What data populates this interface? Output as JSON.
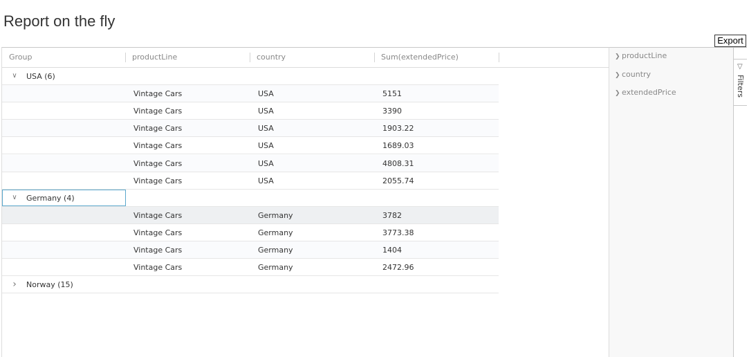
{
  "page": {
    "title": "Report on the fly"
  },
  "toolbar": {
    "export_label": "Export"
  },
  "columns": [
    "Group",
    "productLine",
    "country",
    "Sum(extendedPrice)"
  ],
  "groups": [
    {
      "label": "USA (6)",
      "expanded": true,
      "rows": [
        [
          "Vintage Cars",
          "USA",
          "5151"
        ],
        [
          "Vintage Cars",
          "USA",
          "3390"
        ],
        [
          "Vintage Cars",
          "USA",
          "1903.22"
        ],
        [
          "Vintage Cars",
          "USA",
          "1689.03"
        ],
        [
          "Vintage Cars",
          "USA",
          "4808.31"
        ],
        [
          "Vintage Cars",
          "USA",
          "2055.74"
        ]
      ]
    },
    {
      "label": "Germany (4)",
      "expanded": true,
      "rows": [
        [
          "Vintage Cars",
          "Germany",
          "3782"
        ],
        [
          "Vintage Cars",
          "Germany",
          "3773.38"
        ],
        [
          "Vintage Cars",
          "Germany",
          "1404"
        ],
        [
          "Vintage Cars",
          "Germany",
          "2472.96"
        ]
      ]
    },
    {
      "label": "Norway (15)",
      "expanded": false,
      "rows": []
    }
  ],
  "side_panel": {
    "items": [
      "productLine",
      "country",
      "extendedPrice"
    ]
  },
  "filters_tab": {
    "label": "Filters",
    "icon": "funnel-icon"
  },
  "icons": {
    "expanded": "chevron-down-icon",
    "collapsed": "chevron-right-icon"
  }
}
